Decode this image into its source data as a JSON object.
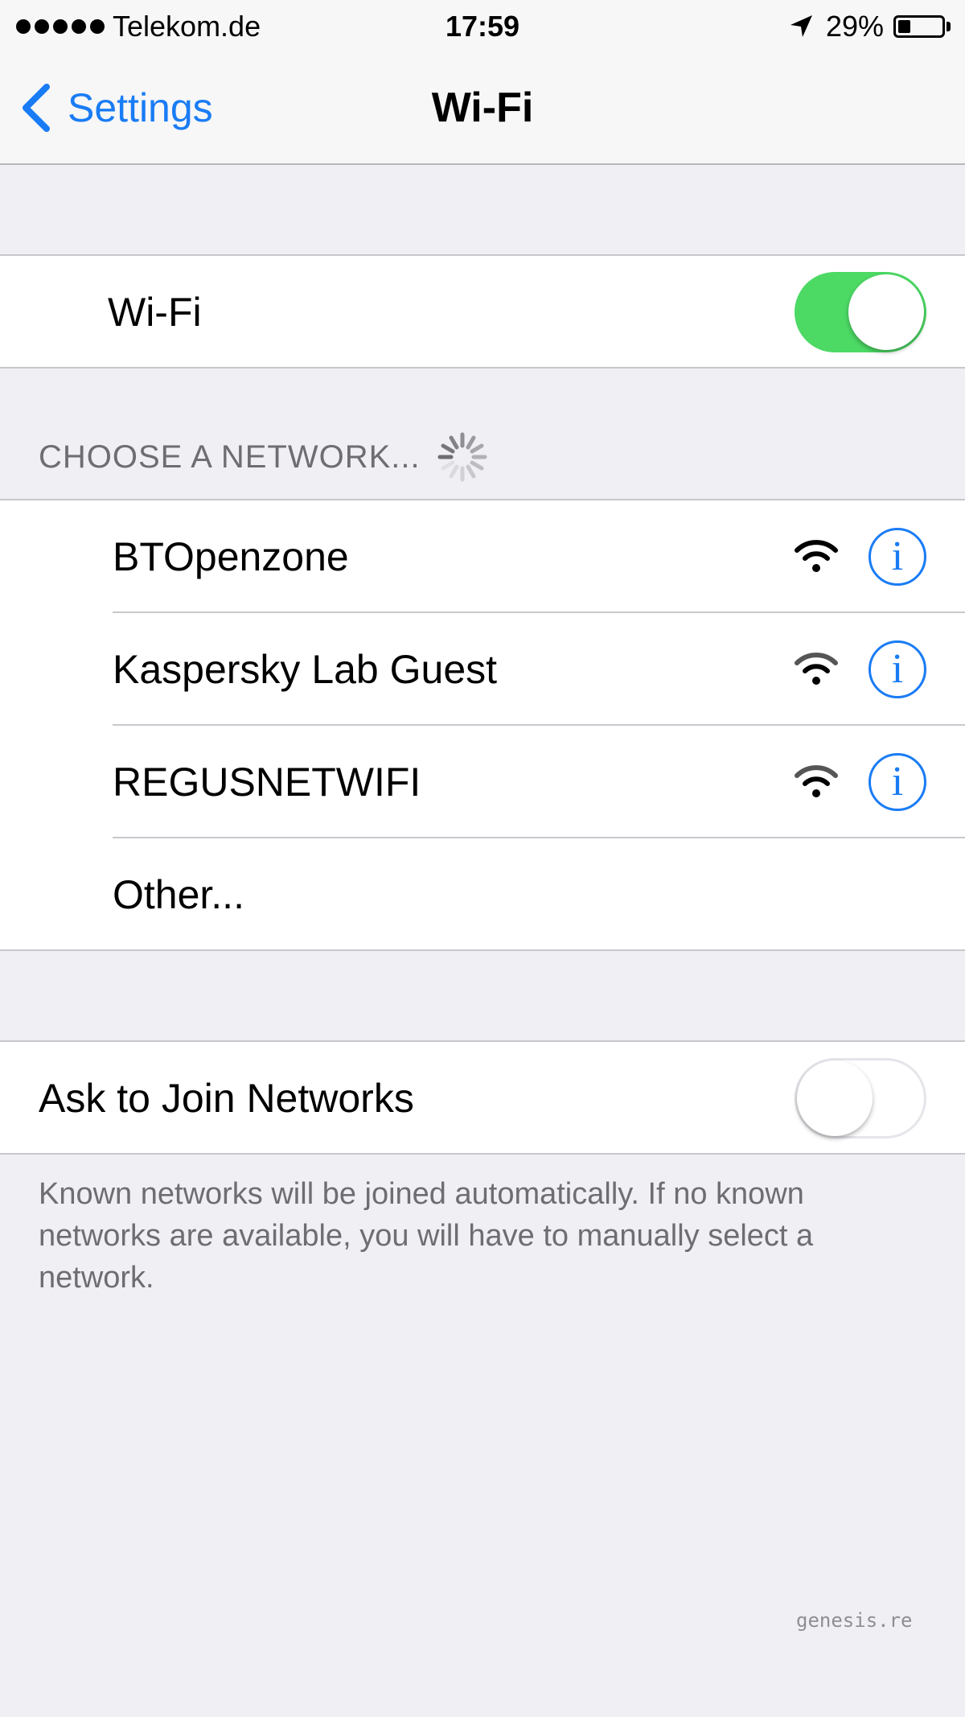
{
  "status_bar": {
    "carrier": "Telekom.de",
    "time": "17:59",
    "battery_percent": "29%",
    "battery_level": 0.29,
    "icons": [
      "signal-dots-icon",
      "location-arrow-icon",
      "battery-icon"
    ]
  },
  "nav": {
    "back_label": "Settings",
    "title": "Wi-Fi"
  },
  "wifi_toggle": {
    "label": "Wi-Fi",
    "on": true
  },
  "networks_section": {
    "header": "CHOOSE A NETWORK...",
    "items": [
      {
        "name": "BTOpenzone",
        "icons": [
          "wifi-signal-icon",
          "info-icon"
        ],
        "info_glyph": "i"
      },
      {
        "name": "Kaspersky Lab Guest",
        "icons": [
          "wifi-signal-icon",
          "info-icon"
        ],
        "info_glyph": "i"
      },
      {
        "name": "REGUSNETWIFI",
        "icons": [
          "wifi-signal-icon",
          "info-icon"
        ],
        "info_glyph": "i"
      }
    ],
    "other_label": "Other..."
  },
  "ask_to_join": {
    "label": "Ask to Join Networks",
    "on": false,
    "footer": "Known networks will be joined automatically. If no known networks are available, you will have to manually select a network."
  },
  "watermark": "genesis.re",
  "colors": {
    "accent": "#1a7cf5",
    "switch_on": "#4cd964",
    "background": "#efeff4"
  }
}
